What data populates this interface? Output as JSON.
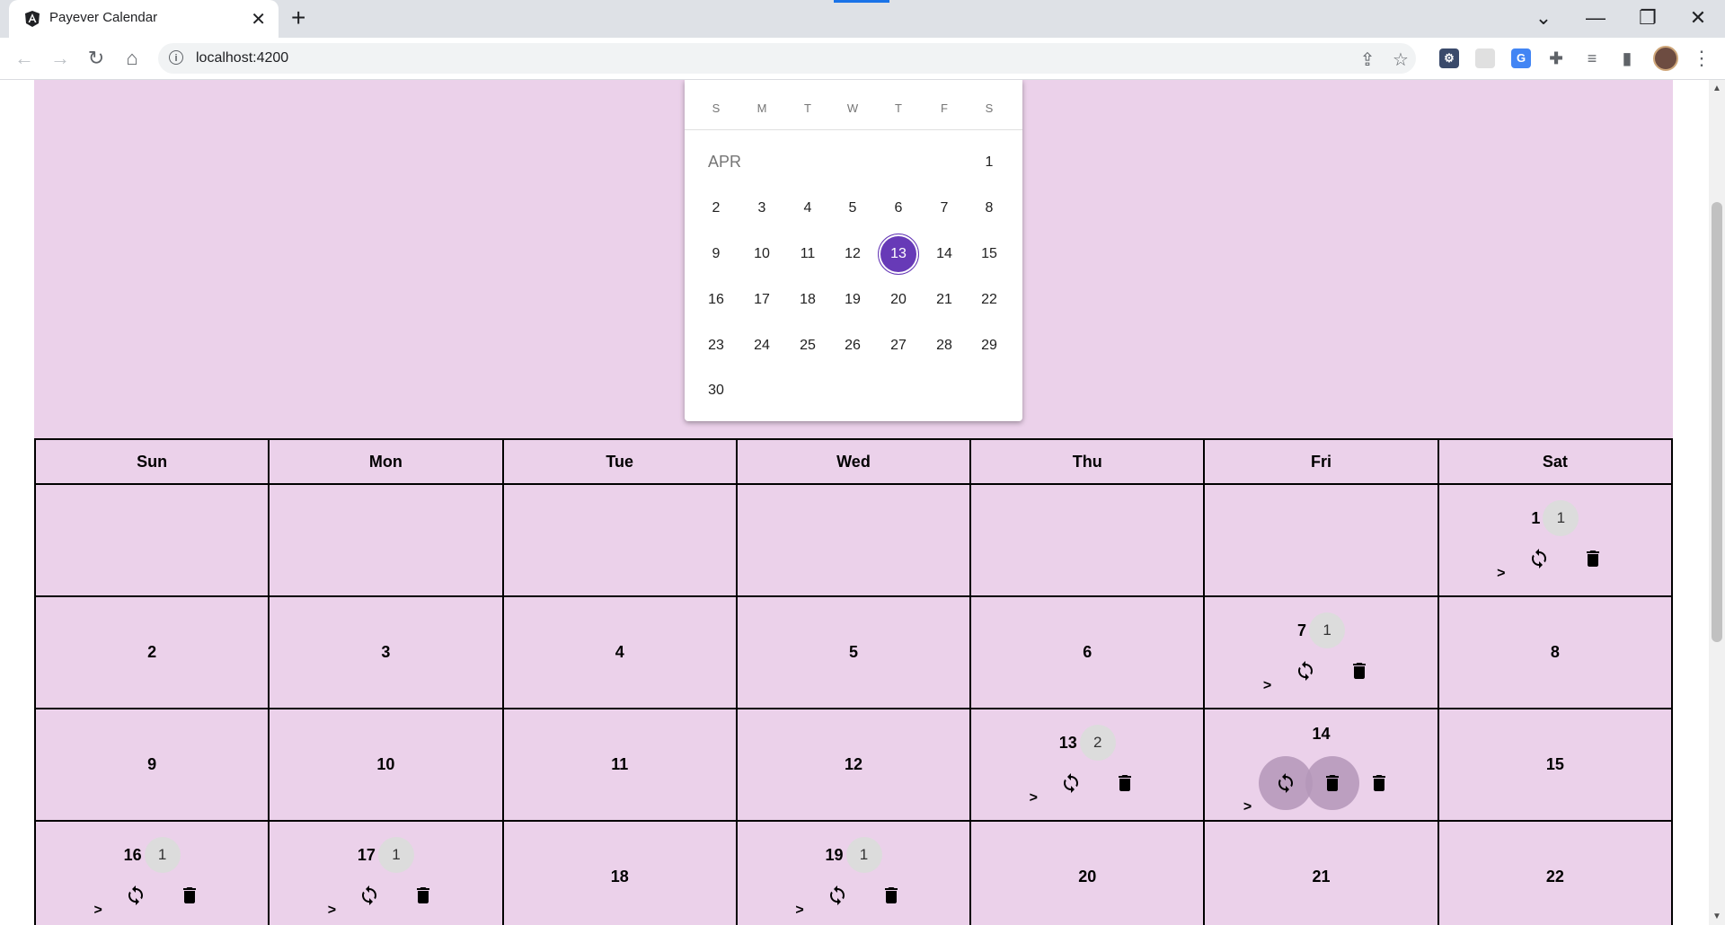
{
  "browser": {
    "tab_title": "Payever Calendar",
    "url": "localhost:4200",
    "close_glyph": "✕",
    "new_tab_glyph": "+",
    "window_controls": {
      "dropdown": "⌄",
      "minimize": "—",
      "restore": "❐",
      "close": "✕"
    },
    "nav": {
      "back": "←",
      "forward": "→",
      "reload": "↻",
      "home": "⌂"
    },
    "omnibox_icons": {
      "info": "i",
      "share": "⇪",
      "bookmark": "☆"
    },
    "extensions": [
      "extension-icon",
      "extension-icon",
      "google-translate-icon",
      "puzzle-icon",
      "media-control-icon",
      "side-panel-icon"
    ],
    "menu_glyph": "⋮"
  },
  "datepicker": {
    "weekdays": [
      "S",
      "M",
      "T",
      "W",
      "T",
      "F",
      "S"
    ],
    "month_label": "APR",
    "weeks": [
      [
        "",
        "",
        "",
        "",
        "",
        "",
        "1"
      ],
      [
        "2",
        "3",
        "4",
        "5",
        "6",
        "7",
        "8"
      ],
      [
        "9",
        "10",
        "11",
        "12",
        "13",
        "14",
        "15"
      ],
      [
        "16",
        "17",
        "18",
        "19",
        "20",
        "21",
        "22"
      ],
      [
        "23",
        "24",
        "25",
        "26",
        "27",
        "28",
        "29"
      ],
      [
        "30",
        "",
        "",
        "",
        "",
        "",
        ""
      ]
    ],
    "selected_day": "13",
    "accent_color": "#673ab7"
  },
  "calendar": {
    "headers": [
      "Sun",
      "Mon",
      "Tue",
      "Wed",
      "Thu",
      "Fri",
      "Sat"
    ],
    "action_gt": ">",
    "weeks": [
      [
        {
          "day": "",
          "count": ""
        },
        {
          "day": "",
          "count": ""
        },
        {
          "day": "",
          "count": ""
        },
        {
          "day": "",
          "count": ""
        },
        {
          "day": "",
          "count": ""
        },
        {
          "day": "",
          "count": ""
        },
        {
          "day": "1",
          "count": "1"
        }
      ],
      [
        {
          "day": "2",
          "count": ""
        },
        {
          "day": "3",
          "count": ""
        },
        {
          "day": "4",
          "count": ""
        },
        {
          "day": "5",
          "count": ""
        },
        {
          "day": "6",
          "count": ""
        },
        {
          "day": "7",
          "count": "1"
        },
        {
          "day": "8",
          "count": ""
        }
      ],
      [
        {
          "day": "9",
          "count": ""
        },
        {
          "day": "10",
          "count": ""
        },
        {
          "day": "11",
          "count": ""
        },
        {
          "day": "12",
          "count": ""
        },
        {
          "day": "13",
          "count": "2"
        },
        {
          "day": "14",
          "count": "",
          "hover": true
        },
        {
          "day": "15",
          "count": ""
        }
      ],
      [
        {
          "day": "16",
          "count": "1"
        },
        {
          "day": "17",
          "count": "1"
        },
        {
          "day": "18",
          "count": ""
        },
        {
          "day": "19",
          "count": "1"
        },
        {
          "day": "20",
          "count": ""
        },
        {
          "day": "21",
          "count": ""
        },
        {
          "day": "22",
          "count": ""
        }
      ]
    ],
    "background_color": "#ebd1ea"
  }
}
